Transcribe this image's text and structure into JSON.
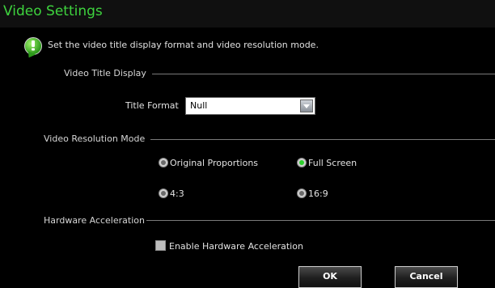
{
  "window": {
    "title": "Video Settings"
  },
  "hint": {
    "text": "Set the video title display format and video resolution mode."
  },
  "video_title_display": {
    "group_label": "Video Title Display",
    "title_format_label": "Title Format",
    "title_format_value": "Null"
  },
  "video_resolution_mode": {
    "group_label": "Video Resolution Mode",
    "options": [
      {
        "label": "Original Proportions",
        "selected": false
      },
      {
        "label": "Full Screen",
        "selected": true
      },
      {
        "label": "4:3",
        "selected": false
      },
      {
        "label": "16:9",
        "selected": false
      }
    ]
  },
  "hardware_acceleration": {
    "group_label": "Hardware Acceleration",
    "checkbox_label": "Enable Hardware Acceleration",
    "checked": false
  },
  "buttons": {
    "ok": "OK",
    "cancel": "Cancel"
  },
  "colors": {
    "title_text": "#3ed33e",
    "radio_selected": "#2ccf2c",
    "background": "#000000"
  }
}
